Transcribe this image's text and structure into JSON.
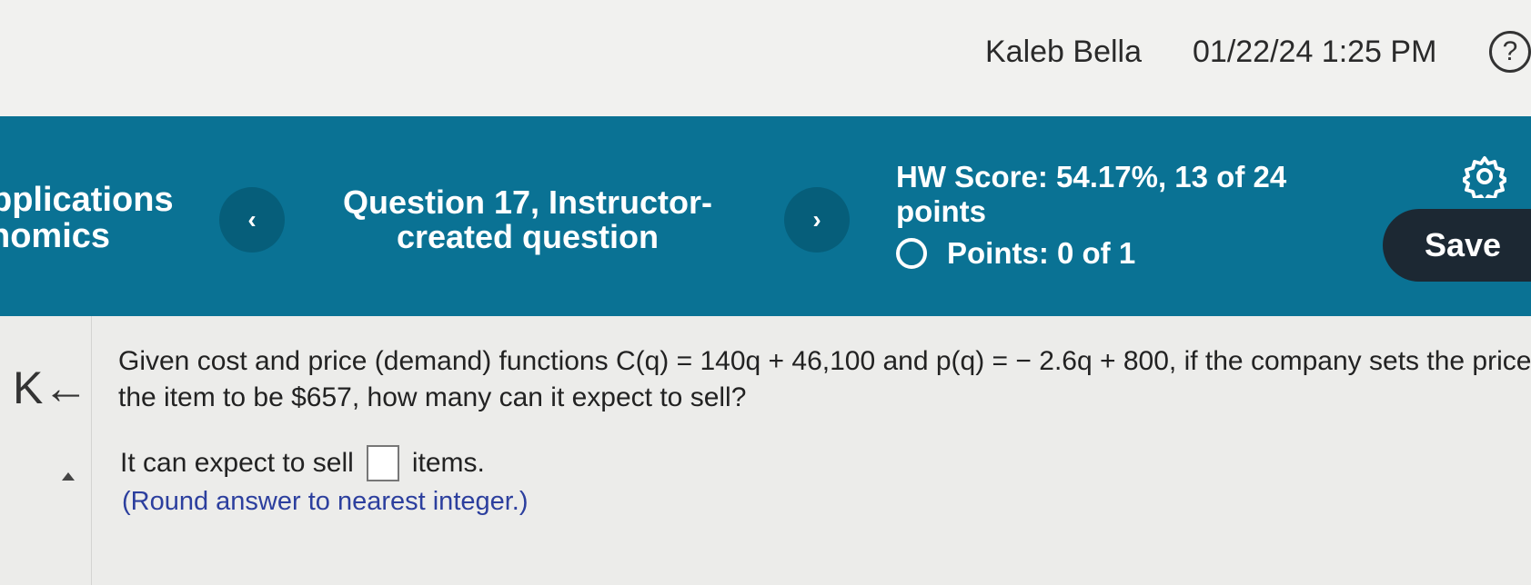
{
  "topbar": {
    "user_name": "Kaleb Bella",
    "datetime": "01/22/24 1:25 PM",
    "help_symbol": "?"
  },
  "header": {
    "course_line1": "pplications",
    "course_line2": "nomics",
    "prev_symbol": "‹",
    "next_symbol": "›",
    "question_title": "Question 17, Instructor-created question",
    "hw_score": "HW Score: 54.17%, 13 of 24 points",
    "points": "Points: 0 of 1",
    "save_label": "Save",
    "icons": {
      "prev": "chevron-left-icon",
      "next": "chevron-right-icon",
      "settings": "gear-icon",
      "status": "circle-outline-icon"
    }
  },
  "content": {
    "collapse_symbol": "K←",
    "question_line1": "Given cost and price (demand) functions C(q) = 140q + 46,100 and p(q) = − 2.6q + 800, if the company sets the price o",
    "question_line2": "the item to be $657, how many can it expect to sell?",
    "answer_prefix": "It can expect to sell",
    "answer_value": "",
    "answer_suffix": "items.",
    "hint": "(Round answer to nearest integer.)"
  },
  "colors": {
    "header_bg": "#0a7294",
    "nav_btn_bg": "#065e7a",
    "save_bg": "#1c2833",
    "hint_text": "#2c3f9e"
  }
}
